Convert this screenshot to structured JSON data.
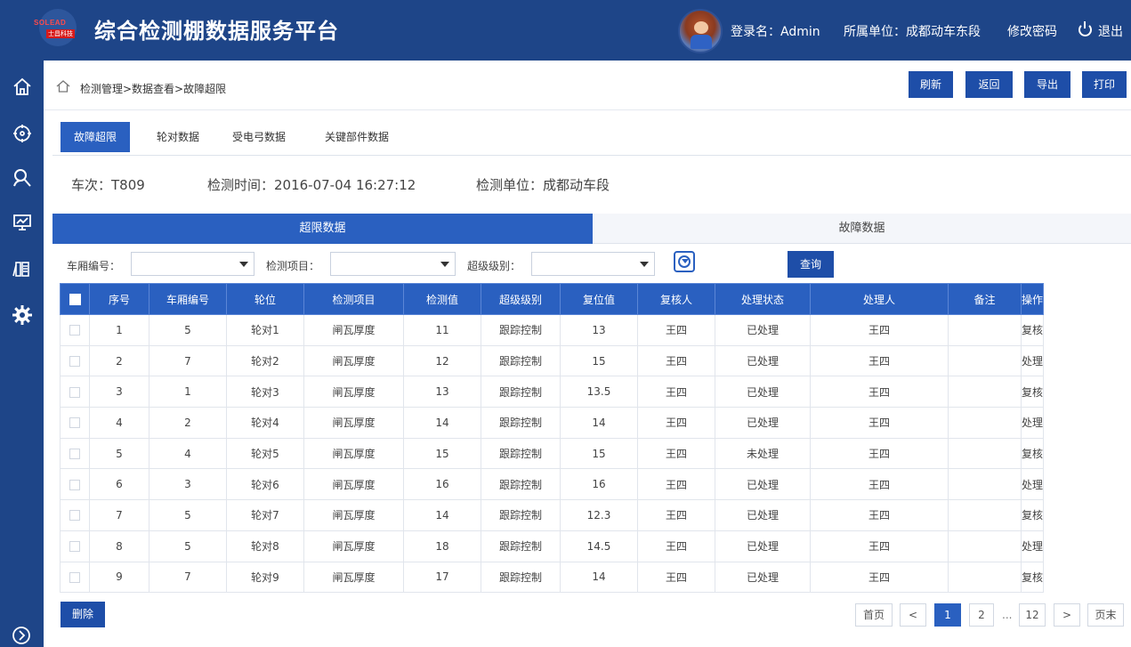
{
  "header": {
    "app_title": "综合检测棚数据服务平台",
    "logo_text": "SOLEAD",
    "logo_sub": "士昌科技",
    "login_label": "登录名：Admin",
    "unit_label": "所属单位：成都动车东段",
    "change_password": "修改密码",
    "logout": "退出"
  },
  "sidebar": {
    "icons": [
      "home-icon",
      "compass-icon",
      "search-user-icon",
      "monitor-chart-icon",
      "archive-icon",
      "gear-icon",
      "expand-icon"
    ]
  },
  "breadcrumb": "检测管理>数据查看>故障超限",
  "toolbar": {
    "refresh": "刷新",
    "back": "返回",
    "export": "导出",
    "print": "打印"
  },
  "tabs": [
    "故障超限",
    "轮对数据",
    "受电弓数据",
    "关键部件数据"
  ],
  "info": {
    "train": "车次：T809",
    "time": "检测时间：2016-07-04 16:27:12",
    "unit": "检测单位：成都动车段"
  },
  "section_tabs": {
    "limit": "超限数据",
    "fault": "故障数据"
  },
  "filters": {
    "car_label": "车厢编号：",
    "item_label": "检测项目：",
    "level_label": "超级级别：",
    "query": "查询"
  },
  "table": {
    "headers": [
      "序号",
      "车厢编号",
      "轮位",
      "检测项目",
      "检测值",
      "超级级别",
      "复位值",
      "复核人",
      "处理状态",
      "处理人",
      "备注",
      "操作"
    ],
    "rows": [
      {
        "no": "1",
        "car": "5",
        "wheel": "轮对1",
        "item": "闸瓦厚度",
        "value": "11",
        "level": "跟踪控制",
        "reset": "13",
        "checker": "王四",
        "status": "已处理",
        "handler": "王四",
        "note": "",
        "action": "复核"
      },
      {
        "no": "2",
        "car": "7",
        "wheel": "轮对2",
        "item": "闸瓦厚度",
        "value": "12",
        "level": "跟踪控制",
        "reset": "15",
        "checker": "王四",
        "status": "已处理",
        "handler": "王四",
        "note": "",
        "action": "处理"
      },
      {
        "no": "3",
        "car": "1",
        "wheel": "轮对3",
        "item": "闸瓦厚度",
        "value": "13",
        "level": "跟踪控制",
        "reset": "13.5",
        "checker": "王四",
        "status": "已处理",
        "handler": "王四",
        "note": "",
        "action": "复核"
      },
      {
        "no": "4",
        "car": "2",
        "wheel": "轮对4",
        "item": "闸瓦厚度",
        "value": "14",
        "level": "跟踪控制",
        "reset": "14",
        "checker": "王四",
        "status": "已处理",
        "handler": "王四",
        "note": "",
        "action": "处理"
      },
      {
        "no": "5",
        "car": "4",
        "wheel": "轮对5",
        "item": "闸瓦厚度",
        "value": "15",
        "level": "跟踪控制",
        "reset": "15",
        "checker": "王四",
        "status": "未处理",
        "handler": "王四",
        "note": "",
        "action": "复核"
      },
      {
        "no": "6",
        "car": "3",
        "wheel": "轮对6",
        "item": "闸瓦厚度",
        "value": "16",
        "level": "跟踪控制",
        "reset": "16",
        "checker": "王四",
        "status": "已处理",
        "handler": "王四",
        "note": "",
        "action": "处理"
      },
      {
        "no": "7",
        "car": "5",
        "wheel": "轮对7",
        "item": "闸瓦厚度",
        "value": "14",
        "level": "跟踪控制",
        "reset": "12.3",
        "checker": "王四",
        "status": "已处理",
        "handler": "王四",
        "note": "",
        "action": "复核"
      },
      {
        "no": "8",
        "car": "5",
        "wheel": "轮对8",
        "item": "闸瓦厚度",
        "value": "18",
        "level": "跟踪控制",
        "reset": "14.5",
        "checker": "王四",
        "status": "已处理",
        "handler": "王四",
        "note": "",
        "action": "处理"
      },
      {
        "no": "9",
        "car": "7",
        "wheel": "轮对9",
        "item": "闸瓦厚度",
        "value": "17",
        "level": "跟踪控制",
        "reset": "14",
        "checker": "王四",
        "status": "已处理",
        "handler": "王四",
        "note": "",
        "action": "复核"
      }
    ]
  },
  "footer": {
    "delete": "删除",
    "first": "首页",
    "prev": "<",
    "pages": [
      "1",
      "2"
    ],
    "ellipsis": "...",
    "last_page": "12",
    "next": ">",
    "end": "页末",
    "current": "1"
  },
  "colors": {
    "brand": "#1e4588",
    "accent": "#2a60c0",
    "unprocessed": "#2a60c0"
  }
}
